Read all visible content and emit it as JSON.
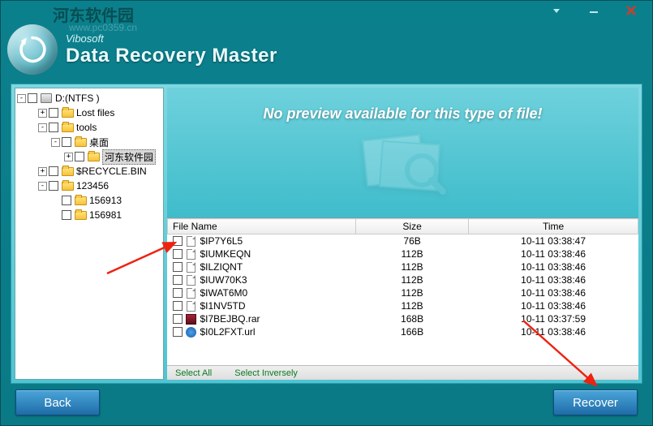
{
  "watermark": {
    "text": "河东软件园",
    "url": "www.pc0359.cn"
  },
  "title": {
    "brand": "Vibosoft",
    "product": "Data Recovery Master"
  },
  "tree": {
    "drive": "D:(NTFS )",
    "items": [
      {
        "label": "Lost files",
        "depth": 1,
        "toggle": "+"
      },
      {
        "label": "tools",
        "depth": 1,
        "toggle": "-"
      },
      {
        "label": "桌面",
        "depth": 2,
        "toggle": "-"
      },
      {
        "label": "河东软件园",
        "depth": 3,
        "toggle": "+",
        "selected": true
      },
      {
        "label": "$RECYCLE.BIN",
        "depth": 1,
        "toggle": "+"
      },
      {
        "label": "123456",
        "depth": 1,
        "toggle": "-"
      },
      {
        "label": "156913",
        "depth": 2,
        "toggle": ""
      },
      {
        "label": "156981",
        "depth": 2,
        "toggle": ""
      }
    ]
  },
  "preview": {
    "message": "No preview available for this type of file!"
  },
  "table": {
    "headers": {
      "name": "File Name",
      "size": "Size",
      "time": "Time"
    },
    "rows": [
      {
        "name": "$IP7Y6L5",
        "size": "76B",
        "time": "10-11 03:38:47",
        "icon": "doc"
      },
      {
        "name": "$IUMKEQN",
        "size": "112B",
        "time": "10-11 03:38:46",
        "icon": "doc"
      },
      {
        "name": "$ILZIQNT",
        "size": "112B",
        "time": "10-11 03:38:46",
        "icon": "doc"
      },
      {
        "name": "$IUW70K3",
        "size": "112B",
        "time": "10-11 03:38:46",
        "icon": "doc"
      },
      {
        "name": "$IWAT6M0",
        "size": "112B",
        "time": "10-11 03:38:46",
        "icon": "doc"
      },
      {
        "name": "$I1NV5TD",
        "size": "112B",
        "time": "10-11 03:38:46",
        "icon": "doc"
      },
      {
        "name": "$I7BEJBQ.rar",
        "size": "168B",
        "time": "10-11 03:37:59",
        "icon": "rar"
      },
      {
        "name": "$I0L2FXT.url",
        "size": "166B",
        "time": "10-11 03:38:46",
        "icon": "ie"
      }
    ]
  },
  "footer": {
    "selectAll": "Select All",
    "selectInverse": "Select Inversely"
  },
  "buttons": {
    "back": "Back",
    "recover": "Recover"
  }
}
